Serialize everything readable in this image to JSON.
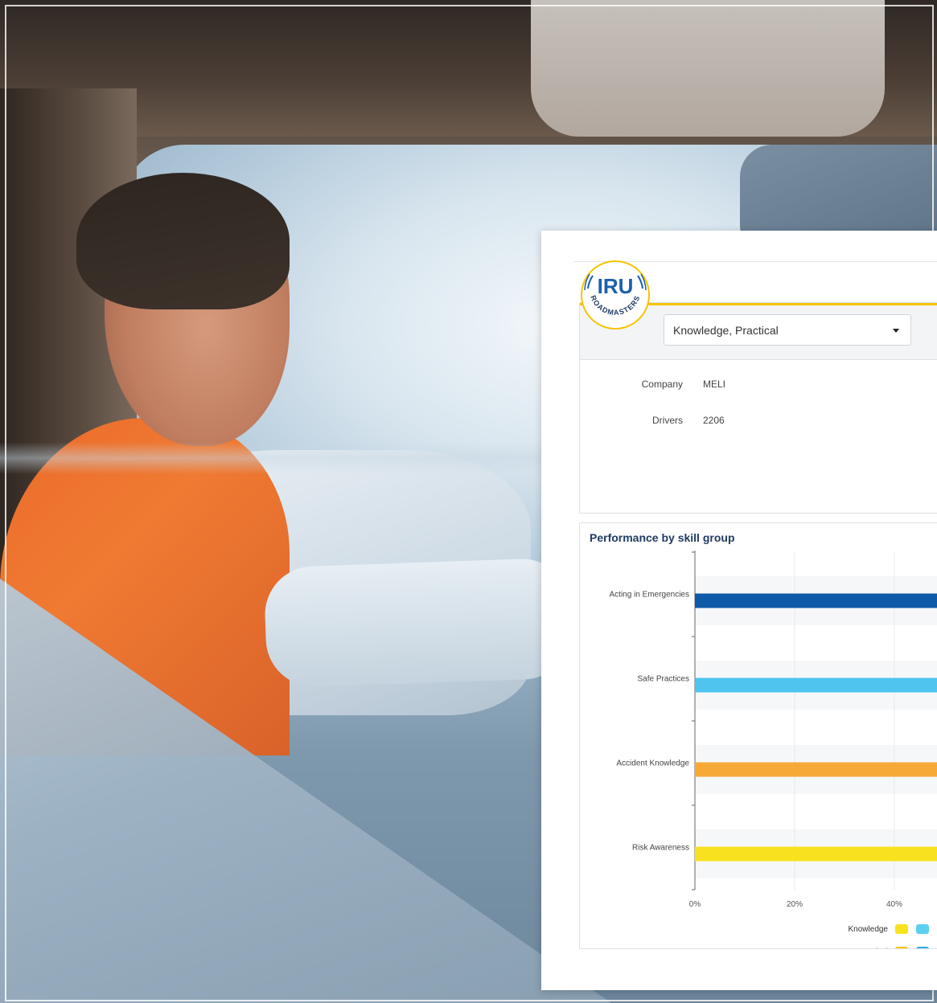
{
  "logo": {
    "main_text": "IRU",
    "arc_text": "ROADMASTERS"
  },
  "filter": {
    "selected": "Knowledge, Practical"
  },
  "info": {
    "company_label": "Company",
    "company_value": "MELI",
    "drivers_label": "Drivers",
    "drivers_value": "2206"
  },
  "chart_data": {
    "type": "bar",
    "orientation": "horizontal",
    "title": "Performance by skill group",
    "categories": [
      "Acting in Emergencies",
      "Safe Practices",
      "Accident Knowledge",
      "Risk Awareness"
    ],
    "series": [
      {
        "color": "#0f5aa8",
        "values": [
          null,
          null,
          null,
          null
        ]
      },
      {
        "color": "#4ec4ef",
        "values": [
          null,
          null,
          null,
          null
        ]
      },
      {
        "color": "#f7a937",
        "values": [
          null,
          null,
          null,
          null
        ]
      },
      {
        "color": "#f8e21f",
        "values": [
          null,
          null,
          null,
          null
        ]
      }
    ],
    "bar_colors": [
      "#0f5aa8",
      "#4ec4ef",
      "#f7a937",
      "#f8e21f"
    ],
    "x_ticks": [
      "0%",
      "20%",
      "40%"
    ],
    "xlim": [
      0,
      40
    ],
    "grid": true,
    "legend": {
      "placement": "bottom",
      "rows": [
        {
          "label": "Knowledge",
          "swatches": [
            "#f8e21f",
            "#5dd0f2"
          ]
        },
        {
          "label": "Practical",
          "swatches": [
            "#f5c400",
            "#2fa9e3"
          ]
        }
      ]
    }
  }
}
